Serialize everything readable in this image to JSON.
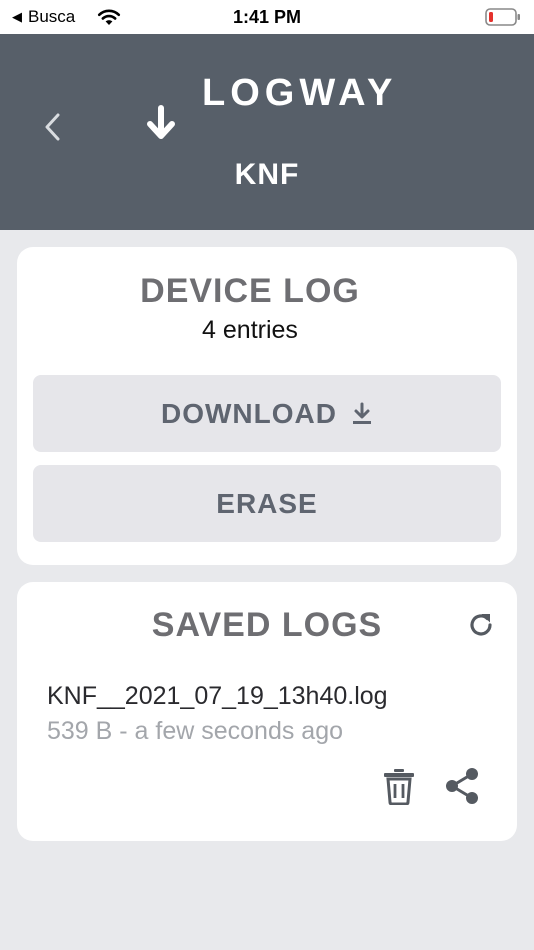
{
  "status_bar": {
    "back_app": "Busca",
    "time": "1:41 PM",
    "icons": [
      "back-triangle-icon",
      "wifi-icon",
      "battery-low-icon"
    ]
  },
  "header": {
    "logo_text": "LOGWAY",
    "device_name": "KNF",
    "colors": {
      "background": "#575f69",
      "logo_accent": "#e8843a"
    }
  },
  "device_log": {
    "title": "DEVICE LOG",
    "entries": "4 entries",
    "download_label": "DOWNLOAD",
    "erase_label": "ERASE"
  },
  "saved_logs": {
    "title": "SAVED LOGS",
    "items": [
      {
        "name": "KNF__2021_07_19_13h40.log",
        "meta": "539 B - a few seconds ago"
      }
    ]
  }
}
